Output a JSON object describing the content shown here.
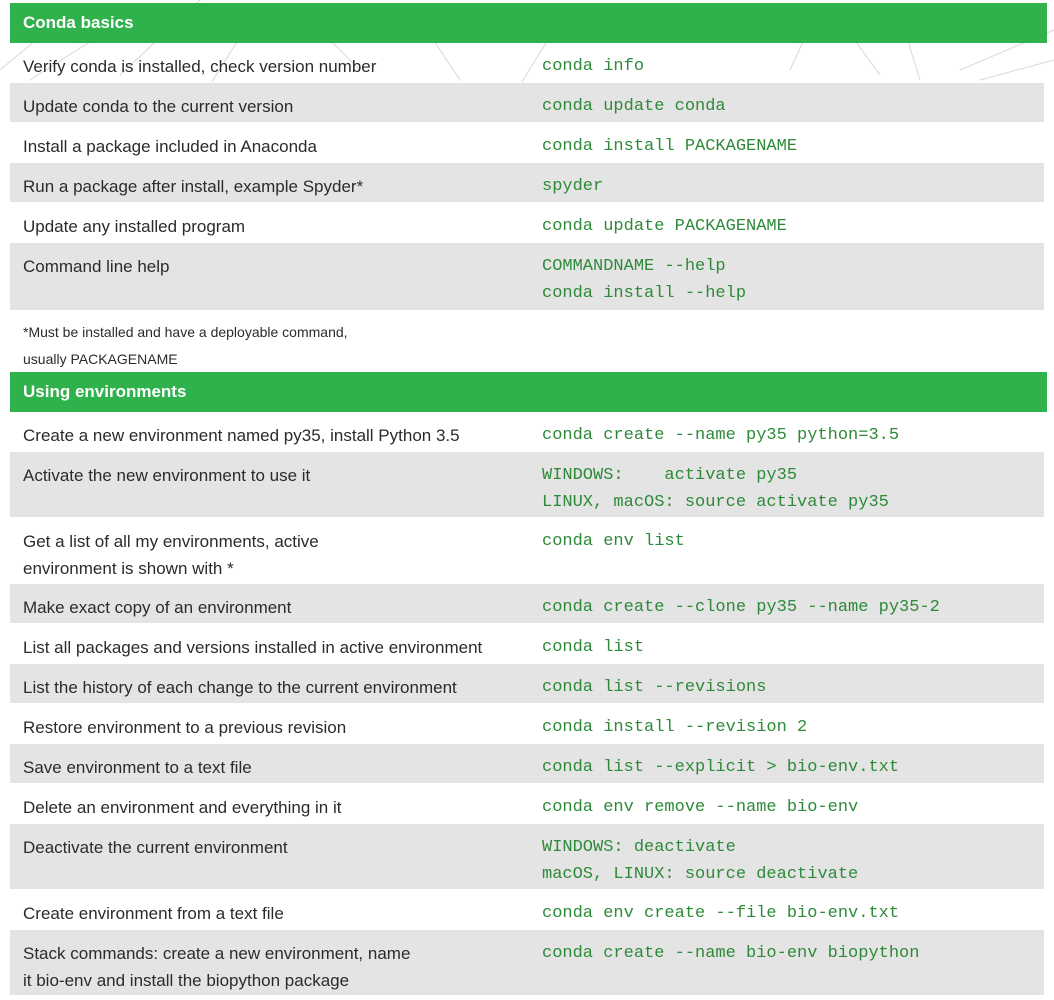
{
  "sections": [
    {
      "title": "Conda basics",
      "rows": [
        {
          "desc": [
            "Verify conda is installed, check version number"
          ],
          "cmd": [
            "conda info"
          ]
        },
        {
          "desc": [
            "Update conda to the current version"
          ],
          "cmd": [
            "conda update conda"
          ]
        },
        {
          "desc": [
            "Install a package included in Anaconda"
          ],
          "cmd": [
            "conda install PACKAGENAME"
          ]
        },
        {
          "desc": [
            "Run a package after install, example Spyder*"
          ],
          "cmd": [
            "spyder"
          ]
        },
        {
          "desc": [
            "Update any installed program"
          ],
          "cmd": [
            "conda update PACKAGENAME"
          ]
        },
        {
          "desc": [
            "Command line help"
          ],
          "cmd": [
            "COMMANDNAME --help",
            "conda install --help"
          ]
        }
      ],
      "footnote": [
        "*Must be installed and have a deployable command,",
        "usually PACKAGENAME"
      ]
    },
    {
      "title": "Using environments",
      "rows": [
        {
          "desc": [
            "Create a new environment named py35, install Python 3.5"
          ],
          "cmd": [
            "conda create --name py35 python=3.5"
          ]
        },
        {
          "desc": [
            "Activate the new environment to use it"
          ],
          "cmd": [
            "WINDOWS:    activate py35",
            "LINUX, macOS: source activate py35"
          ]
        },
        {
          "desc": [
            "Get a list of all my environments, active",
            "environment is shown with *"
          ],
          "cmd": [
            "conda env list"
          ]
        },
        {
          "desc": [
            "Make exact copy of an environment"
          ],
          "cmd": [
            "conda create --clone py35 --name py35-2"
          ]
        },
        {
          "desc": [
            "List all packages and versions installed in active environment"
          ],
          "cmd": [
            "conda list"
          ]
        },
        {
          "desc": [
            "List the history of each change to the current environment"
          ],
          "cmd": [
            "conda list --revisions"
          ]
        },
        {
          "desc": [
            "Restore environment to a previous revision"
          ],
          "cmd": [
            "conda install --revision 2"
          ]
        },
        {
          "desc": [
            "Save environment to a text file"
          ],
          "cmd": [
            "conda list --explicit > bio-env.txt"
          ]
        },
        {
          "desc": [
            "Delete an environment and everything in it"
          ],
          "cmd": [
            "conda env remove --name bio-env"
          ]
        },
        {
          "desc": [
            "Deactivate the current environment"
          ],
          "cmd": [
            "WINDOWS: deactivate",
            "macOS, LINUX: source deactivate"
          ]
        },
        {
          "desc": [
            "Create environment from a text file"
          ],
          "cmd": [
            "conda env create --file bio-env.txt"
          ]
        },
        {
          "desc": [
            "Stack commands: create a new environment, name",
            "it bio-env and install the biopython package"
          ],
          "cmd": [
            "conda create --name bio-env biopython"
          ]
        }
      ]
    }
  ],
  "colors": {
    "header_bg": "#2fb14c",
    "row_shade": "#e4e4e4",
    "command_text": "#2e8a39"
  }
}
